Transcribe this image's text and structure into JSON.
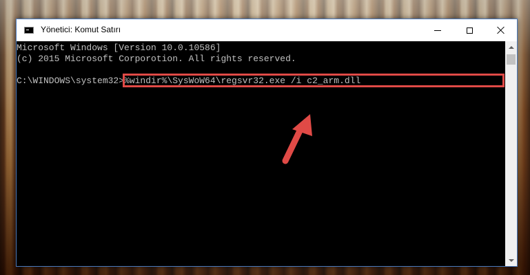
{
  "window": {
    "title": "Yönetici: Komut Satırı",
    "controls": {
      "minimize_icon": "minimize-icon",
      "maximize_icon": "maximize-icon",
      "close_icon": "close-icon"
    }
  },
  "console": {
    "lines": [
      "Microsoft Windows [Version 10.0.10586]",
      "(c) 2015 Microsoft Corporotion. All rights reserved."
    ],
    "prompt": "C:\\WINDOWS\\system32>",
    "command": "%windir%\\SysWoW64\\regsvr32.exe /i c2_arm.dll"
  },
  "annotation": {
    "highlight_color": "#e04a46",
    "arrow_icon": "arrow-pointer-icon"
  },
  "colors": {
    "console_bg": "#000000",
    "console_text": "#c0c0c0",
    "titlebar_bg": "#ffffff",
    "window_border": "#4a7bbf"
  }
}
